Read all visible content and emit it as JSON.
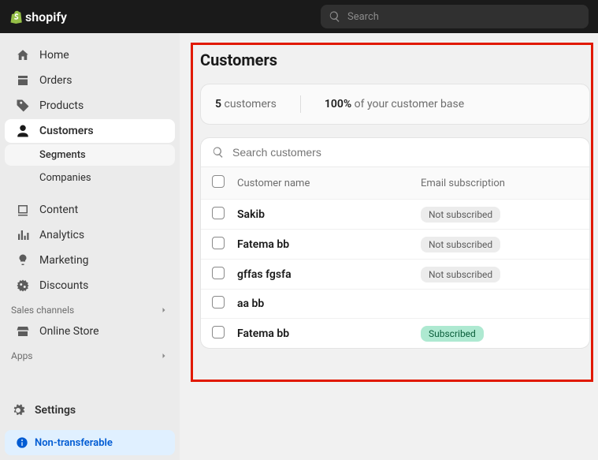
{
  "topbar": {
    "brand": "shopify",
    "search_placeholder": "Search"
  },
  "sidebar": {
    "items": [
      {
        "label": "Home"
      },
      {
        "label": "Orders"
      },
      {
        "label": "Products"
      },
      {
        "label": "Customers"
      },
      {
        "label": "Content"
      },
      {
        "label": "Analytics"
      },
      {
        "label": "Marketing"
      },
      {
        "label": "Discounts"
      }
    ],
    "customers_sub": [
      {
        "label": "Segments"
      },
      {
        "label": "Companies"
      }
    ],
    "sales_channels_label": "Sales channels",
    "online_store": "Online Store",
    "apps_label": "Apps",
    "settings": "Settings",
    "nontransferable": "Non-transferable"
  },
  "page": {
    "title": "Customers",
    "stat1_num": "5",
    "stat1_text": "customers",
    "stat2_num": "100%",
    "stat2_text": "of your customer base",
    "search_placeholder": "Search customers",
    "col_name": "Customer name",
    "col_sub": "Email subscription",
    "rows": [
      {
        "name": "Sakib",
        "sub": "Not subscribed",
        "sub_style": "gray"
      },
      {
        "name": "Fatema bb",
        "sub": "Not subscribed",
        "sub_style": "gray"
      },
      {
        "name": "gffas fgsfa",
        "sub": "Not subscribed",
        "sub_style": "gray"
      },
      {
        "name": "aa bb",
        "sub": "",
        "sub_style": ""
      },
      {
        "name": "Fatema bb",
        "sub": "Subscribed",
        "sub_style": "green"
      }
    ]
  }
}
